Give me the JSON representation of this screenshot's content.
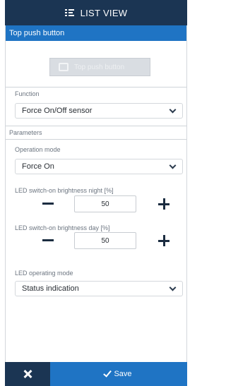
{
  "header": {
    "title": "LIST VIEW",
    "icon": "list-view-icon"
  },
  "section": {
    "title": "Top push button"
  },
  "preview": {
    "label": "Top push button",
    "icon": "push-button-icon"
  },
  "function": {
    "label": "Function",
    "value": "Force On/Off sensor"
  },
  "parameters": {
    "label": "Parameters"
  },
  "operation_mode": {
    "label": "Operation mode",
    "value": "Force On"
  },
  "brightness_night": {
    "label": "LED switch-on brightness night [%]",
    "value": "50"
  },
  "brightness_day": {
    "label": "LED switch-on brightness day [%]",
    "value": "50"
  },
  "led_mode": {
    "label": "LED operating mode",
    "value": "Status indication"
  },
  "footer": {
    "save_label": "Save"
  },
  "colors": {
    "dark_navy": "#1b3553",
    "accent_blue": "#1f74c4"
  }
}
